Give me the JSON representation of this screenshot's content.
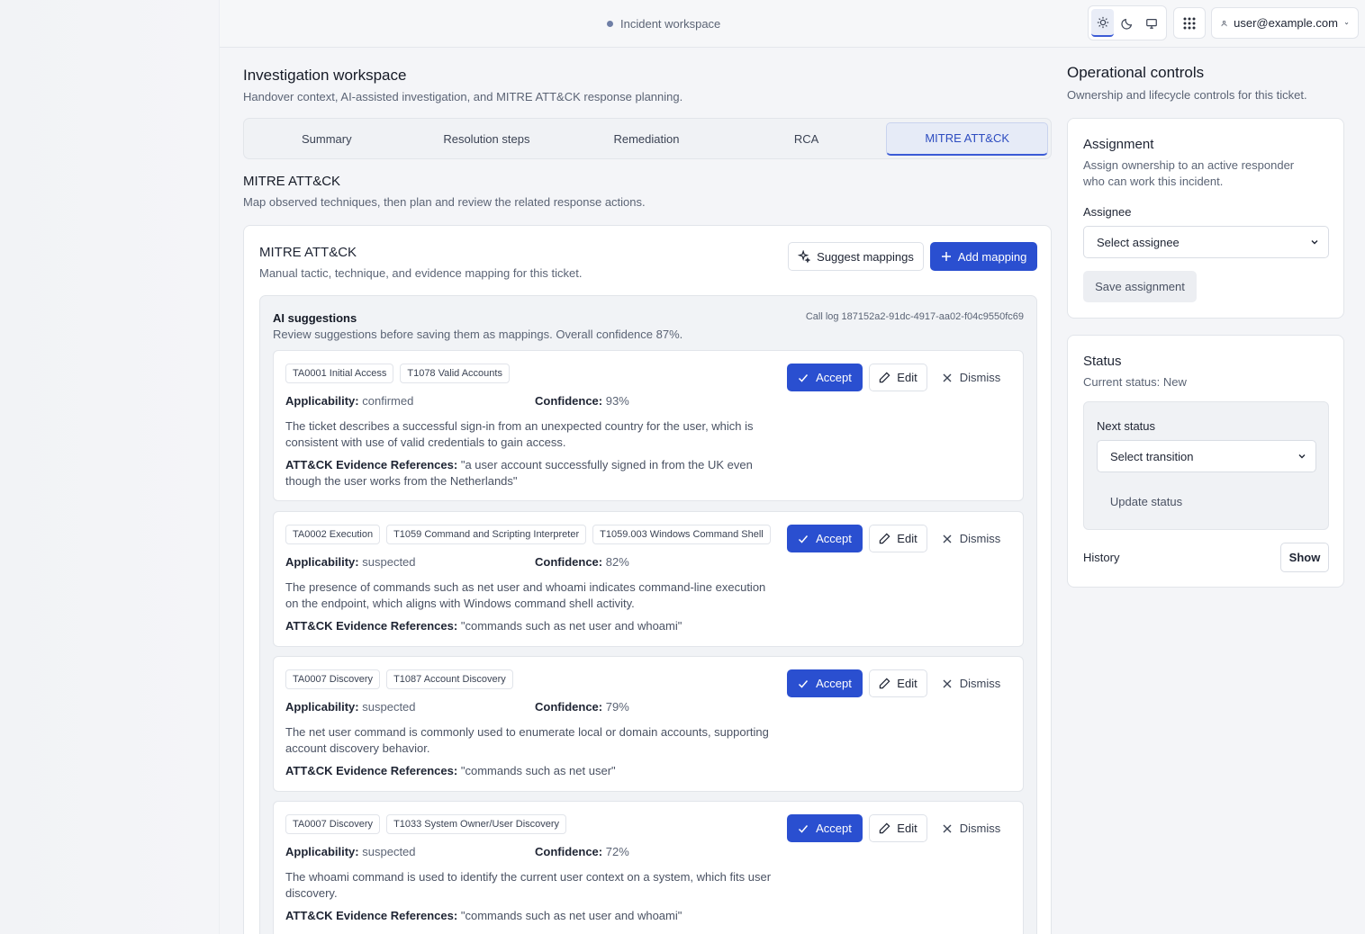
{
  "topbar": {
    "workspace_label": "Incident workspace",
    "user_email": "user@example.com"
  },
  "page": {
    "title": "Investigation workspace",
    "subtitle": "Handover context, AI-assisted investigation, and MITRE ATT&CK response planning."
  },
  "tabs": [
    {
      "label": "Summary",
      "active": false
    },
    {
      "label": "Resolution steps",
      "active": false
    },
    {
      "label": "Remediation",
      "active": false
    },
    {
      "label": "RCA",
      "active": false
    },
    {
      "label": "MITRE ATT&CK",
      "active": true
    }
  ],
  "section": {
    "title": "MITRE ATT&CK",
    "subtitle": "Map observed techniques, then plan and review the related response actions."
  },
  "card": {
    "title": "MITRE ATT&CK",
    "subtitle": "Manual tactic, technique, and evidence mapping for this ticket.",
    "suggest_label": "Suggest mappings",
    "add_label": "Add mapping"
  },
  "ai": {
    "title": "AI suggestions",
    "subtitle": "Review suggestions before saving them as mappings. Overall confidence 87%.",
    "call_log": "Call log 187152a2-91dc-4917-aa02-f04c9550fc69",
    "labels": {
      "applicability": "Applicability:",
      "confidence": "Confidence:",
      "evidence": "ATT&CK Evidence References:",
      "accept": "Accept",
      "edit": "Edit",
      "dismiss": "Dismiss"
    },
    "suggestions": [
      {
        "tags": [
          "TA0001 Initial Access",
          "T1078 Valid Accounts"
        ],
        "applicability": "confirmed",
        "confidence": "93%",
        "description": "The ticket describes a successful sign-in from an unexpected country for the user, which is consistent with use of valid credentials to gain access.",
        "evidence": "\"a user account successfully signed in from the UK even though the user works from the Netherlands\""
      },
      {
        "tags": [
          "TA0002 Execution",
          "T1059 Command and Scripting Interpreter",
          "T1059.003 Windows Command Shell"
        ],
        "applicability": "suspected",
        "confidence": "82%",
        "description": "The presence of commands such as net user and whoami indicates command-line execution on the endpoint, which aligns with Windows command shell activity.",
        "evidence": "\"commands such as net user and whoami\""
      },
      {
        "tags": [
          "TA0007 Discovery",
          "T1087 Account Discovery"
        ],
        "applicability": "suspected",
        "confidence": "79%",
        "description": "The net user command is commonly used to enumerate local or domain accounts, supporting account discovery behavior.",
        "evidence": "\"commands such as net user\""
      },
      {
        "tags": [
          "TA0007 Discovery",
          "T1033 System Owner/User Discovery"
        ],
        "applicability": "suspected",
        "confidence": "72%",
        "description": "The whoami command is used to identify the current user context on a system, which fits user discovery.",
        "evidence": "\"commands such as net user and whoami\""
      }
    ]
  },
  "right": {
    "title": "Operational controls",
    "subtitle": "Ownership and lifecycle controls for this ticket.",
    "assignment": {
      "title": "Assignment",
      "subtitle": "Assign ownership to an active responder who can work this incident.",
      "assignee_label": "Assignee",
      "assignee_placeholder": "Select assignee",
      "save_label": "Save assignment"
    },
    "status": {
      "title": "Status",
      "current": "Current status: New",
      "next_label": "Next status",
      "transition_placeholder": "Select transition",
      "update_label": "Update status",
      "history_label": "History",
      "show_label": "Show"
    }
  },
  "colors": {
    "accent": "#2a4fd0",
    "active_tab_bg": "#e6ebf7"
  }
}
